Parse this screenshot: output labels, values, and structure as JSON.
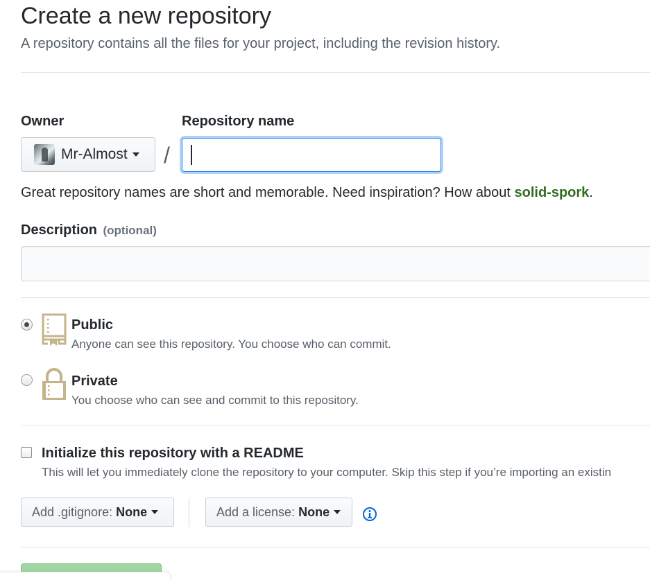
{
  "header": {
    "title": "Create a new repository",
    "subtitle": "A repository contains all the files for your project, including the revision history."
  },
  "owner": {
    "label": "Owner",
    "selected": "Mr-Almost",
    "avatar_icon": "user-avatar"
  },
  "separator": "/",
  "repository_name": {
    "label": "Repository name",
    "value": "",
    "placeholder": ""
  },
  "hint": {
    "text_before": "Great repository names are short and memorable. Need inspiration? How about ",
    "suggestion": "solid-spork",
    "text_after": ".",
    "suggestion_color": "#2f6e20"
  },
  "description": {
    "label": "Description",
    "optional": "(optional)",
    "value": "",
    "placeholder": ""
  },
  "visibility": {
    "selected": "public",
    "options": [
      {
        "id": "public",
        "label": "Public",
        "description": "Anyone can see this repository. You choose who can commit.",
        "icon": "repo-book-icon"
      },
      {
        "id": "private",
        "label": "Private",
        "description": "You choose who can see and commit to this repository.",
        "icon": "lock-icon"
      }
    ]
  },
  "readme": {
    "checked": false,
    "label": "Initialize this repository with a README",
    "description": "This will let you immediately clone the repository to your computer. Skip this step if you’re importing an existin"
  },
  "gitignore": {
    "prefix": "Add .gitignore:",
    "value": "None"
  },
  "license": {
    "prefix": "Add a license:",
    "value": "None",
    "info_icon": "info-icon"
  },
  "colors": {
    "accent_blue": "#0366d6",
    "create_button_green": "#94d3a2",
    "icon_tan": "#c4b48a"
  }
}
